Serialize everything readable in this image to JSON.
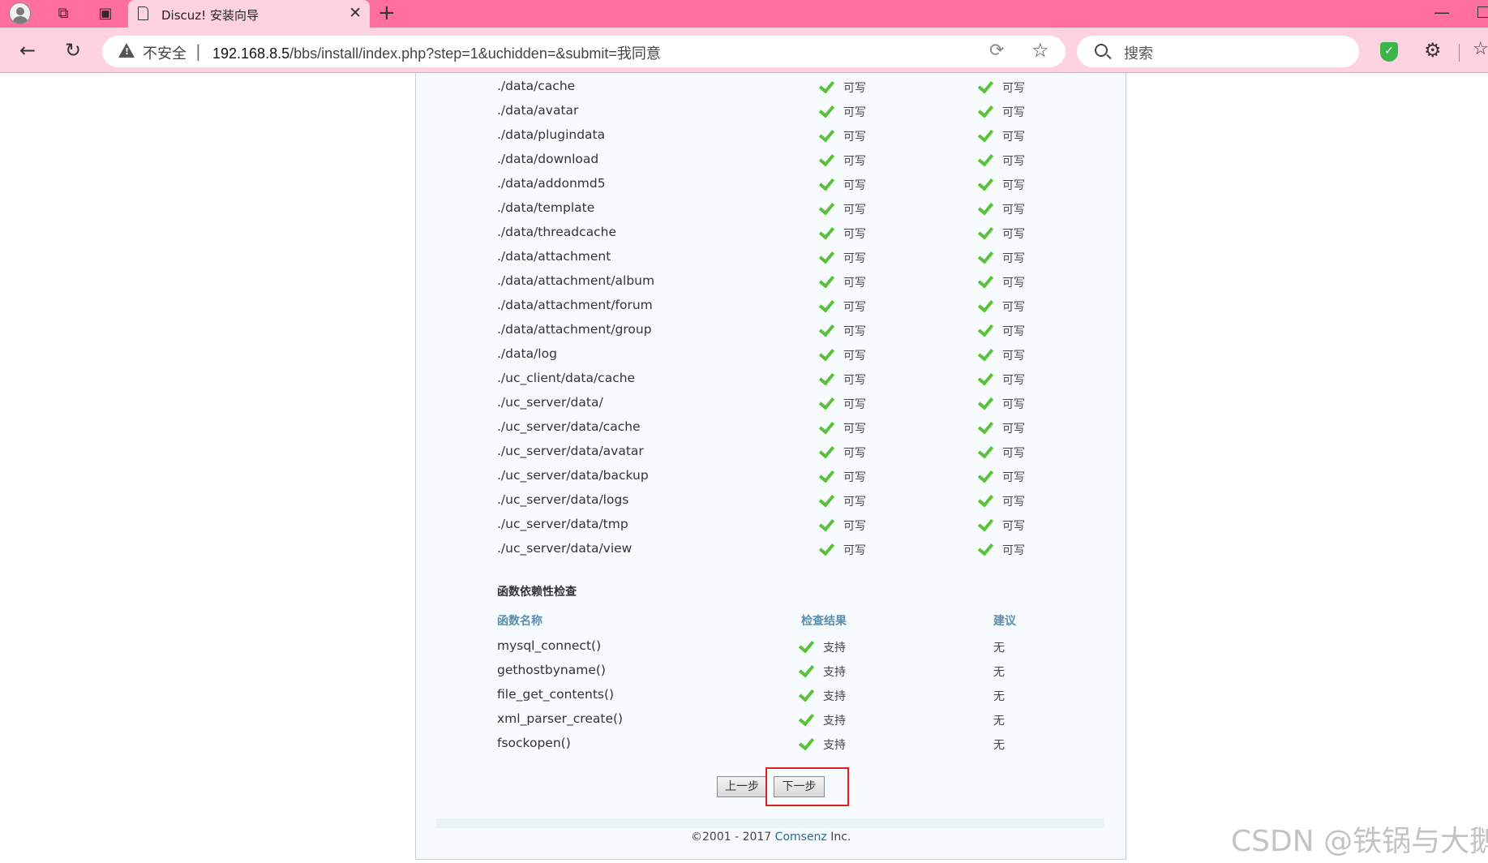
{
  "browser": {
    "tab_title": "Discuz! 安装向导",
    "insecure_label": "不安全",
    "url_host": "192.168.8.5",
    "url_path": "/bbs/install/index.php?step=1&uchidden=&submit=我同意",
    "search_placeholder": "搜索"
  },
  "dirs": [
    {
      "path": "./data/cache",
      "current": "可写",
      "required": "可写"
    },
    {
      "path": "./data/avatar",
      "current": "可写",
      "required": "可写"
    },
    {
      "path": "./data/plugindata",
      "current": "可写",
      "required": "可写"
    },
    {
      "path": "./data/download",
      "current": "可写",
      "required": "可写"
    },
    {
      "path": "./data/addonmd5",
      "current": "可写",
      "required": "可写"
    },
    {
      "path": "./data/template",
      "current": "可写",
      "required": "可写"
    },
    {
      "path": "./data/threadcache",
      "current": "可写",
      "required": "可写"
    },
    {
      "path": "./data/attachment",
      "current": "可写",
      "required": "可写"
    },
    {
      "path": "./data/attachment/album",
      "current": "可写",
      "required": "可写"
    },
    {
      "path": "./data/attachment/forum",
      "current": "可写",
      "required": "可写"
    },
    {
      "path": "./data/attachment/group",
      "current": "可写",
      "required": "可写"
    },
    {
      "path": "./data/log",
      "current": "可写",
      "required": "可写"
    },
    {
      "path": "./uc_client/data/cache",
      "current": "可写",
      "required": "可写"
    },
    {
      "path": "./uc_server/data/",
      "current": "可写",
      "required": "可写"
    },
    {
      "path": "./uc_server/data/cache",
      "current": "可写",
      "required": "可写"
    },
    {
      "path": "./uc_server/data/avatar",
      "current": "可写",
      "required": "可写"
    },
    {
      "path": "./uc_server/data/backup",
      "current": "可写",
      "required": "可写"
    },
    {
      "path": "./uc_server/data/logs",
      "current": "可写",
      "required": "可写"
    },
    {
      "path": "./uc_server/data/tmp",
      "current": "可写",
      "required": "可写"
    },
    {
      "path": "./uc_server/data/view",
      "current": "可写",
      "required": "可写"
    }
  ],
  "functions": {
    "title": "函数依赖性检查",
    "headers": {
      "name": "函数名称",
      "result": "检查结果",
      "advice": "建议"
    },
    "rows": [
      {
        "name": "mysql_connect()",
        "result": "支持",
        "advice": "无"
      },
      {
        "name": "gethostbyname()",
        "result": "支持",
        "advice": "无"
      },
      {
        "name": "file_get_contents()",
        "result": "支持",
        "advice": "无"
      },
      {
        "name": "xml_parser_create()",
        "result": "支持",
        "advice": "无"
      },
      {
        "name": "fsockopen()",
        "result": "支持",
        "advice": "无"
      }
    ]
  },
  "buttons": {
    "prev": "上一步",
    "next": "下一步"
  },
  "footer": {
    "copyright": "©2001 - 2017",
    "brand": "Comsenz",
    "suffix": "Inc."
  },
  "watermark": "CSDN @铁锅与大鹅",
  "colors": {
    "tabbar": "#ff6f9d",
    "check": "#5cc13a",
    "highlight": "#e01f1f",
    "col_head": "#5a8eb0"
  }
}
